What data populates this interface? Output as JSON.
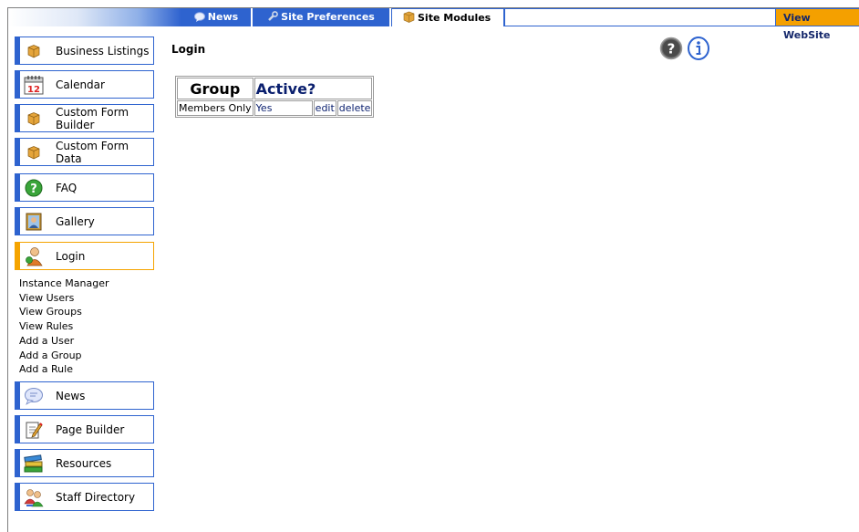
{
  "nav": {
    "tabs": [
      {
        "label": "News",
        "icon": "speech-bubble-icon"
      },
      {
        "label": "Site Preferences",
        "icon": "wrench-icon"
      },
      {
        "label": "Site Modules",
        "icon": "box-icon"
      }
    ],
    "view_website": "View WebSite"
  },
  "colors": {
    "accent_blue": "#2e63cf",
    "active_orange": "#f5a400"
  },
  "sidebar": {
    "modules": [
      {
        "label": "Business Listings",
        "icon": "box-icon"
      },
      {
        "label": "Calendar",
        "icon": "calendar-icon",
        "day": "12"
      },
      {
        "label": "Custom Form Builder",
        "icon": "box-icon"
      },
      {
        "label": "Custom Form Data",
        "icon": "box-icon"
      },
      {
        "label": "FAQ",
        "icon": "question-icon"
      },
      {
        "label": "Gallery",
        "icon": "picture-icon"
      },
      {
        "label": "Login",
        "icon": "user-icon",
        "active": true
      },
      {
        "label": "News",
        "icon": "speech-bubble-icon"
      },
      {
        "label": "Page Builder",
        "icon": "edit-page-icon"
      },
      {
        "label": "Resources",
        "icon": "books-icon"
      },
      {
        "label": "Staff Directory",
        "icon": "people-icon"
      }
    ],
    "login_links": [
      "Instance Manager",
      "View Users",
      "View Groups",
      "View Rules",
      "Add a User",
      "Add a Group",
      "Add a Rule"
    ]
  },
  "main": {
    "title": "Login",
    "table": {
      "headers": [
        "Group",
        "Active?"
      ],
      "rows": [
        {
          "group": "Members Only",
          "active": "Yes",
          "edit": "edit",
          "delete": "delete"
        }
      ]
    }
  }
}
